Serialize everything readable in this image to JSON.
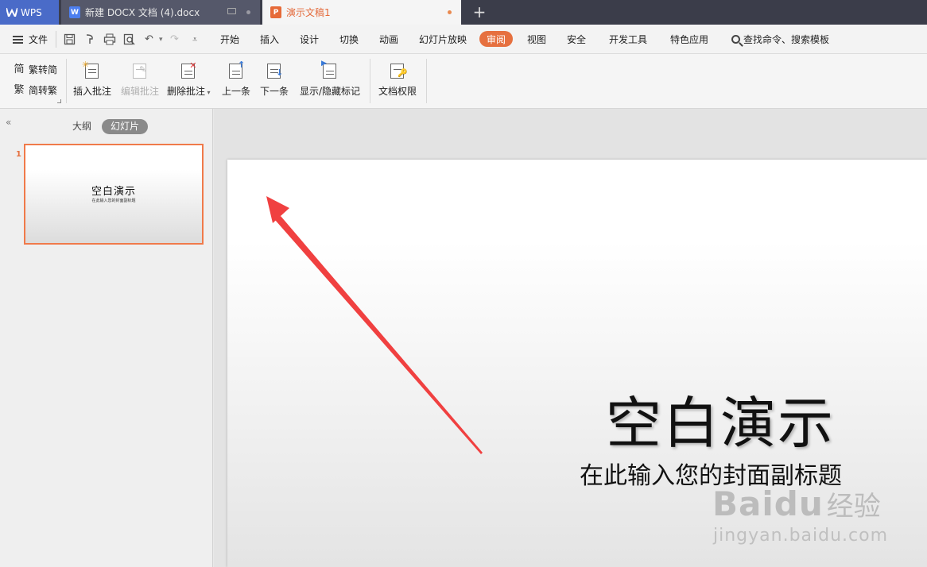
{
  "titlebar": {
    "app": "WPS",
    "tabs": [
      {
        "label": "新建 DOCX 文档 (4).docx",
        "icon": "W"
      },
      {
        "label": "演示文稿1",
        "icon": "P"
      }
    ],
    "new_tab": "+"
  },
  "menubar": {
    "file": "文件",
    "quick_access": {
      "undo": "↶",
      "dropdown": "▾",
      "redo": "↷",
      "more": "⩡"
    },
    "items": [
      "开始",
      "插入",
      "设计",
      "切换",
      "动画",
      "幻灯片放映",
      "审阅",
      "视图",
      "安全",
      "开发工具",
      "特色应用"
    ],
    "active": "审阅",
    "search": "查找命令、搜索模板"
  },
  "ribbon": {
    "trad_to_simp": "繁转简",
    "simp_to_trad": "简转繁",
    "buttons": [
      "插入批注",
      "编辑批注",
      "删除批注",
      "上一条",
      "下一条",
      "显示/隐藏标记",
      "文档权限"
    ]
  },
  "left_panel": {
    "collapse": "«",
    "tabs": [
      "大纲",
      "幻灯片"
    ],
    "slide_number": "1",
    "thumb_title": "空白演示",
    "thumb_subtitle": "在此输入您的封面副标题"
  },
  "slide": {
    "title": "空白演示",
    "subtitle": "在此输入您的封面副标题"
  },
  "watermark": {
    "brand": "Bai",
    "brand2": "du",
    "cn": "经验",
    "url": "jingyan.baidu.com"
  },
  "colors": {
    "accent": "#e6703f",
    "arrow": "#f04040",
    "titlebar": "#3b3d4a"
  }
}
